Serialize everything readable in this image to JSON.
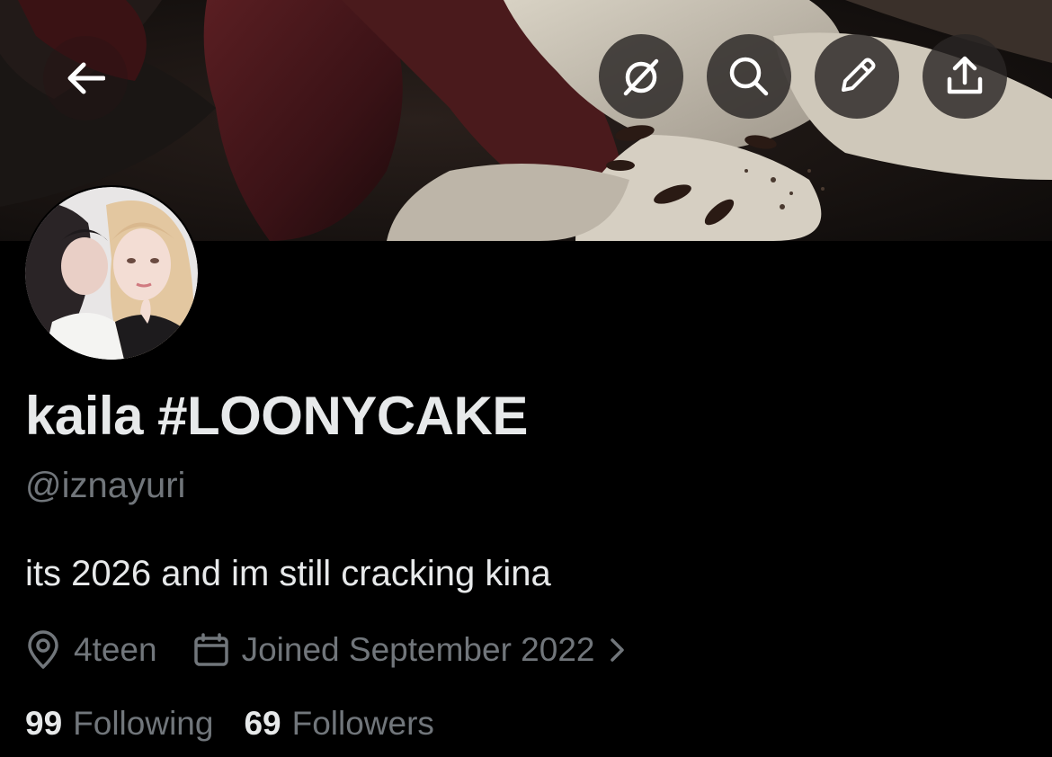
{
  "header": {
    "back_icon": "arrow-left-icon",
    "actions": [
      {
        "name": "grok-icon"
      },
      {
        "name": "search-icon"
      },
      {
        "name": "edit-icon"
      },
      {
        "name": "share-icon"
      }
    ]
  },
  "profile": {
    "display_name": "kaila #LOONYCAKE",
    "handle": "@iznayuri",
    "bio": "its 2026 and im still cracking kina",
    "location": "4teen",
    "joined": "Joined September 2022",
    "following_count": "99",
    "following_label": "Following",
    "followers_count": "69",
    "followers_label": "Followers"
  },
  "colors": {
    "background": "#000000",
    "primary_text": "#e7e9ea",
    "secondary_text": "#71767b"
  }
}
